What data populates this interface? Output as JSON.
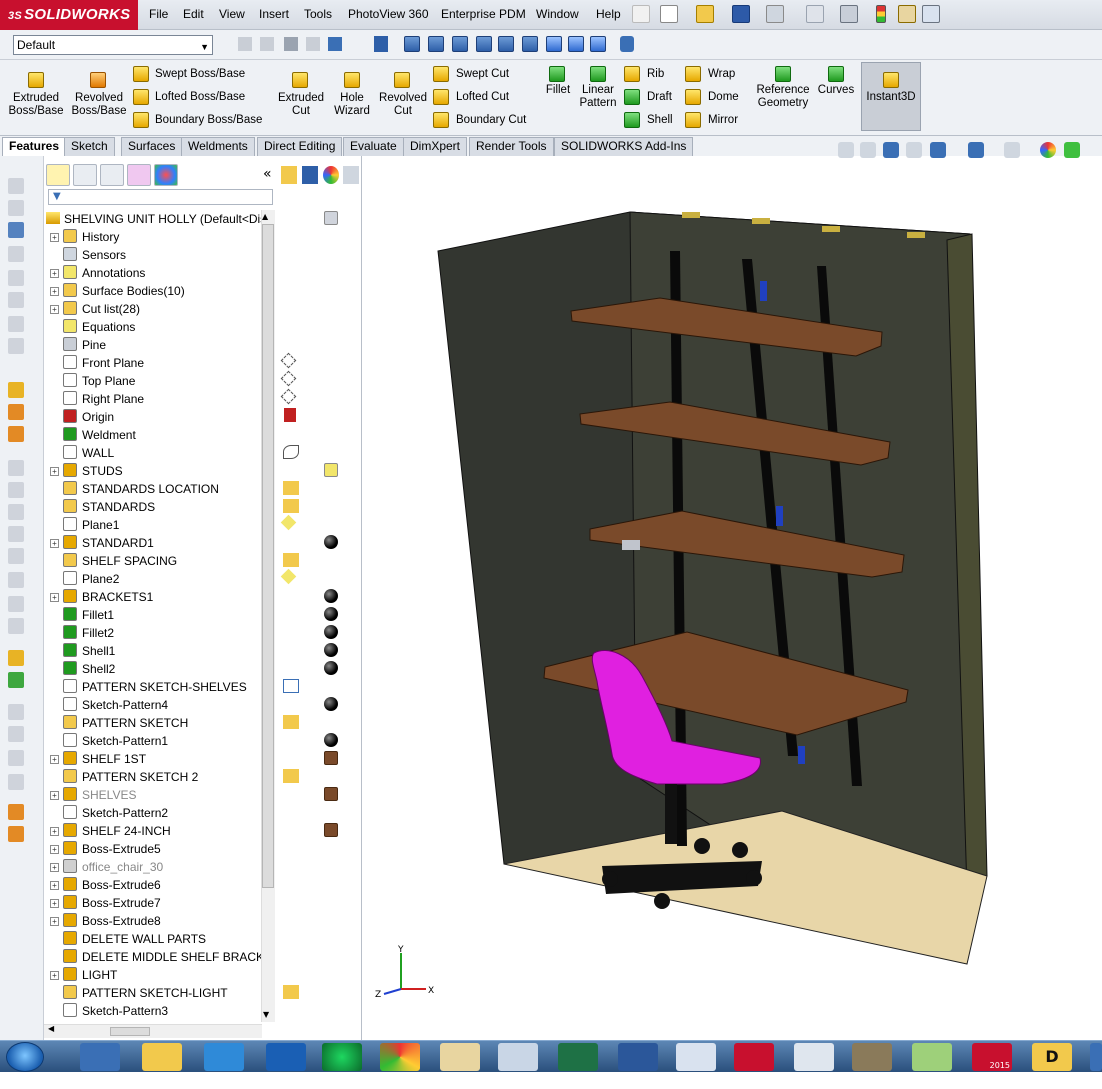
{
  "app": {
    "logo_text": "SOLIDWORKS",
    "logo_prefix": "3S"
  },
  "menu": [
    "File",
    "Edit",
    "View",
    "Insert",
    "Tools",
    "PhotoView 360",
    "Enterprise PDM",
    "Window",
    "Help"
  ],
  "configuration": {
    "selected": "Default"
  },
  "ribbon": {
    "extruded_boss": "Extruded Boss/Base",
    "revolved_boss": "Revolved Boss/Base",
    "swept_boss": "Swept Boss/Base",
    "lofted_boss": "Lofted Boss/Base",
    "boundary_boss": "Boundary Boss/Base",
    "extruded_cut": "Extruded Cut",
    "hole_wizard": "Hole Wizard",
    "revolved_cut": "Revolved Cut",
    "swept_cut": "Swept Cut",
    "lofted_cut": "Lofted Cut",
    "boundary_cut": "Boundary Cut",
    "fillet": "Fillet",
    "linear_pattern": "Linear Pattern",
    "rib": "Rib",
    "draft": "Draft",
    "shell": "Shell",
    "wrap": "Wrap",
    "dome": "Dome",
    "mirror": "Mirror",
    "reference_geometry": "Reference Geometry",
    "curves": "Curves",
    "instant3d": "Instant3D"
  },
  "tabs": [
    "Features",
    "Sketch",
    "Surfaces",
    "Weldments",
    "Direct Editing",
    "Evaluate",
    "DimXpert",
    "Render Tools",
    "SOLIDWORKS Add-Ins"
  ],
  "tree": {
    "root": "SHELVING UNIT HOLLY  (Default<Dis",
    "items": [
      {
        "label": "History",
        "plus": true,
        "icon": "history-icon"
      },
      {
        "label": "Sensors",
        "plus": false,
        "icon": "sensors-icon"
      },
      {
        "label": "Annotations",
        "plus": true,
        "icon": "annotations-icon"
      },
      {
        "label": "Surface Bodies(10)",
        "plus": true,
        "icon": "surface-bodies-icon"
      },
      {
        "label": "Cut list(28)",
        "plus": true,
        "icon": "cut-list-icon"
      },
      {
        "label": "Equations",
        "plus": false,
        "icon": "equations-icon"
      },
      {
        "label": "Pine",
        "plus": false,
        "icon": "material-icon"
      },
      {
        "label": "Front Plane",
        "plus": false,
        "icon": "plane-icon"
      },
      {
        "label": "Top Plane",
        "plus": false,
        "icon": "plane-icon"
      },
      {
        "label": "Right Plane",
        "plus": false,
        "icon": "plane-icon"
      },
      {
        "label": "Origin",
        "plus": false,
        "icon": "origin-icon"
      },
      {
        "label": "Weldment",
        "plus": false,
        "icon": "weldment-icon"
      },
      {
        "label": "WALL",
        "plus": false,
        "icon": "sketch-icon"
      },
      {
        "label": "STUDS",
        "plus": true,
        "icon": "feature-icon"
      },
      {
        "label": "STANDARDS LOCATION",
        "plus": false,
        "icon": "3dsketch-icon"
      },
      {
        "label": "STANDARDS",
        "plus": false,
        "icon": "3dsketch-icon"
      },
      {
        "label": "Plane1",
        "plus": false,
        "icon": "plane-icon"
      },
      {
        "label": "STANDARD1",
        "plus": true,
        "icon": "feature-icon"
      },
      {
        "label": "SHELF SPACING",
        "plus": false,
        "icon": "3dsketch-icon"
      },
      {
        "label": "Plane2",
        "plus": false,
        "icon": "plane-icon"
      },
      {
        "label": "BRACKETS1",
        "plus": true,
        "icon": "feature-icon"
      },
      {
        "label": "Fillet1",
        "plus": false,
        "icon": "fillet-icon"
      },
      {
        "label": "Fillet2",
        "plus": false,
        "icon": "fillet-icon"
      },
      {
        "label": "Shell1",
        "plus": false,
        "icon": "shell-icon"
      },
      {
        "label": "Shell2",
        "plus": false,
        "icon": "shell-icon"
      },
      {
        "label": "PATTERN SKETCH-SHELVES",
        "plus": false,
        "icon": "sketch-icon"
      },
      {
        "label": "Sketch-Pattern4",
        "plus": false,
        "icon": "sketch-pattern-icon"
      },
      {
        "label": "PATTERN SKETCH",
        "plus": false,
        "icon": "3dsketch-icon"
      },
      {
        "label": "Sketch-Pattern1",
        "plus": false,
        "icon": "sketch-pattern-icon"
      },
      {
        "label": "SHELF 1ST",
        "plus": true,
        "icon": "feature-icon"
      },
      {
        "label": "PATTERN SKETCH 2",
        "plus": false,
        "icon": "3dsketch-icon"
      },
      {
        "label": "SHELVES",
        "plus": true,
        "icon": "feature-icon",
        "dim": true
      },
      {
        "label": "Sketch-Pattern2",
        "plus": false,
        "icon": "sketch-pattern-icon"
      },
      {
        "label": "SHELF 24-INCH",
        "plus": true,
        "icon": "feature-icon"
      },
      {
        "label": "Boss-Extrude5",
        "plus": true,
        "icon": "feature-icon"
      },
      {
        "label": "office_chair_30",
        "plus": true,
        "icon": "part-icon",
        "dim": true
      },
      {
        "label": "Boss-Extrude6",
        "plus": true,
        "icon": "feature-icon"
      },
      {
        "label": "Boss-Extrude7",
        "plus": true,
        "icon": "feature-icon"
      },
      {
        "label": "Boss-Extrude8",
        "plus": true,
        "icon": "feature-icon"
      },
      {
        "label": "DELETE WALL PARTS",
        "plus": false,
        "icon": "delete-body-icon"
      },
      {
        "label": "DELETE MIDDLE SHELF BRACKETS",
        "plus": false,
        "icon": "delete-body-icon"
      },
      {
        "label": "LIGHT",
        "plus": true,
        "icon": "feature-icon"
      },
      {
        "label": "PATTERN SKETCH-LIGHT",
        "plus": false,
        "icon": "3dsketch-icon"
      },
      {
        "label": "Sketch-Pattern3",
        "plus": false,
        "icon": "sketch-pattern-icon"
      }
    ]
  },
  "triad": {
    "y": "Y",
    "z": "Z",
    "x": "X"
  },
  "colors": {
    "accent": "#c8102e",
    "wall": "#2f3329",
    "shelf": "#7a4a2a",
    "floor": "#e8d6a8",
    "chair": "#e020e0"
  },
  "taskbar_apps": [
    "start-icon",
    "media-player-icon",
    "file-explorer-icon",
    "internet-explorer-icon",
    "outlook-icon",
    "spotify-icon",
    "chrome-icon",
    "paint-icon",
    "folder-icon",
    "excel-icon",
    "word-icon",
    "calculator-icon",
    "fortinet-icon",
    "notepad-icon",
    "gimp-icon",
    "notepad-plus-icon",
    "solidworks-2015-icon",
    "draftsight-icon"
  ],
  "taskbar_labels": {
    "solidworks": "2015",
    "draftsight": "D"
  }
}
